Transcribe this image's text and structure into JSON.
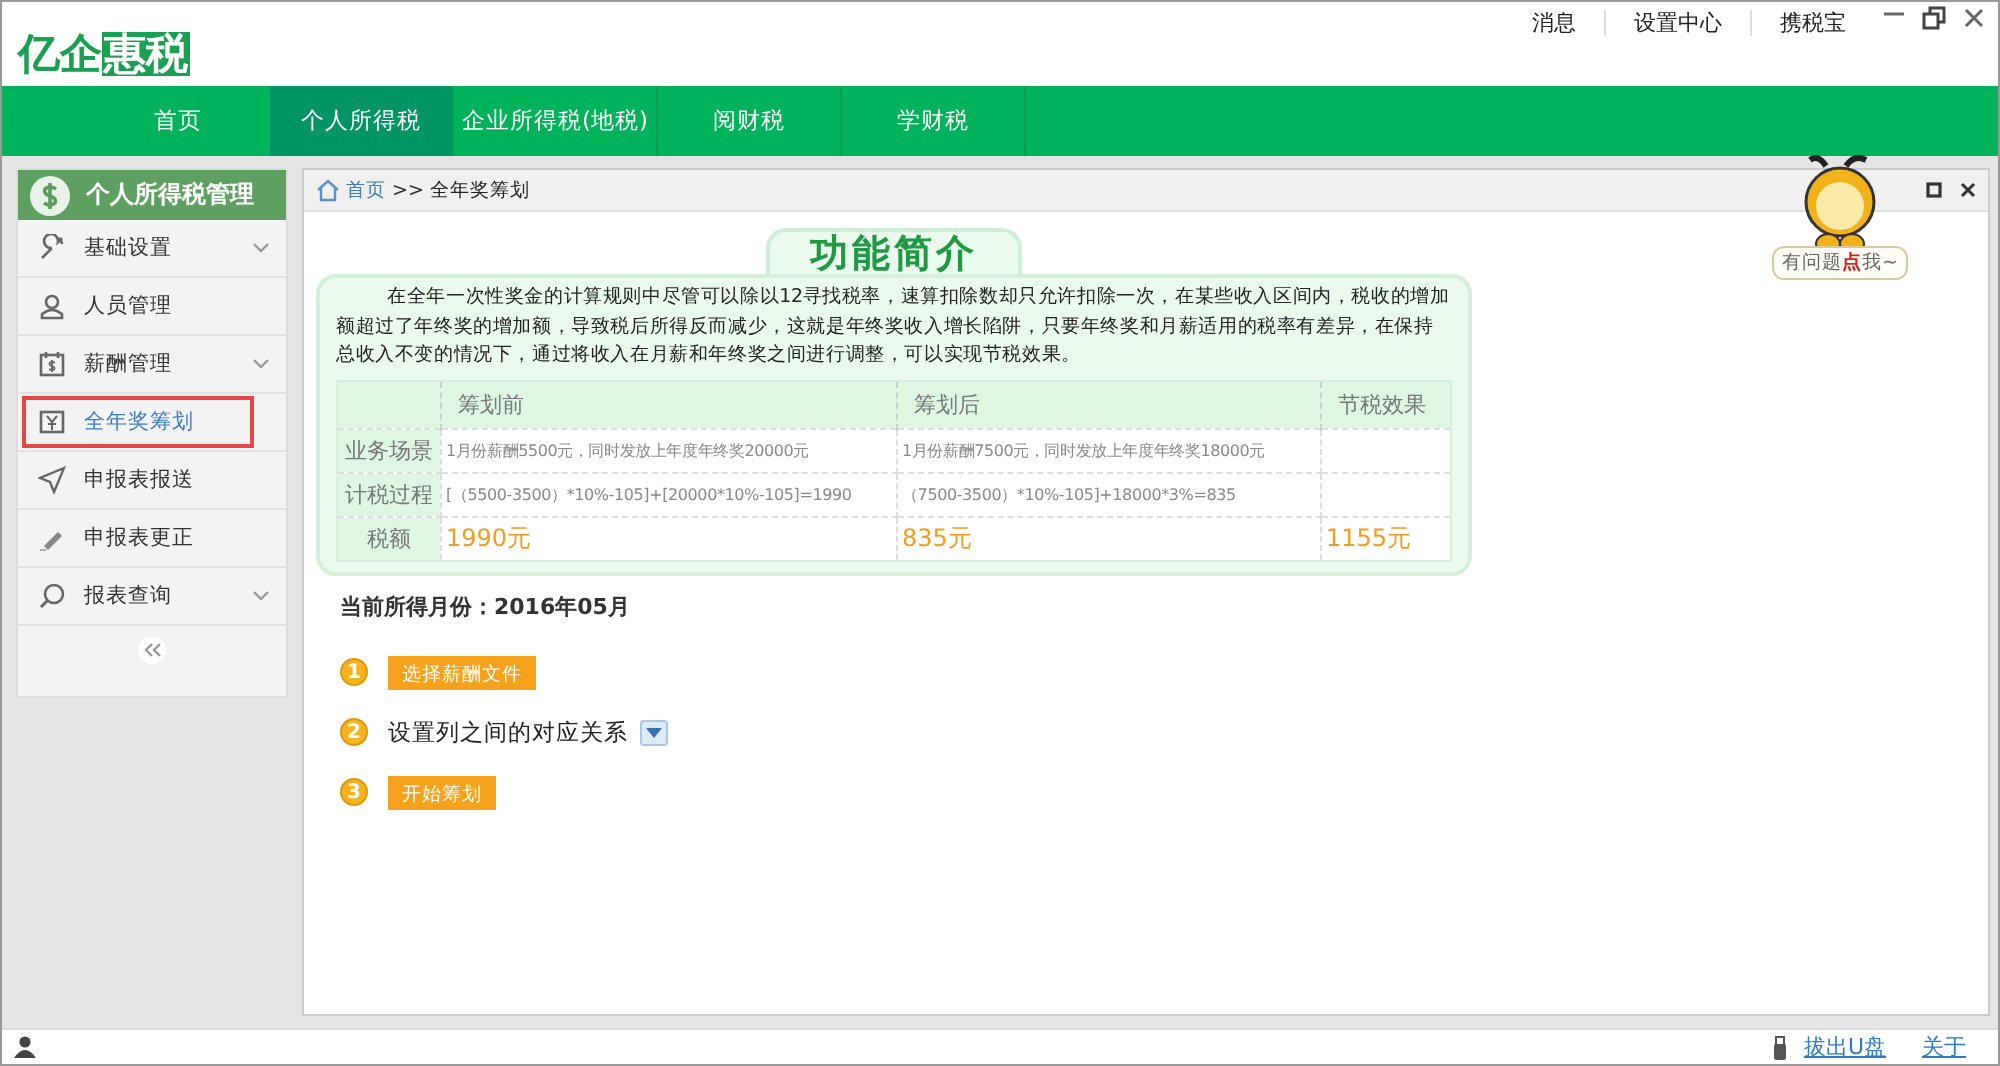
{
  "logo": {
    "plain": "亿企",
    "boxed": "惠税"
  },
  "top_links": [
    "消息",
    "设置中心",
    "携税宝"
  ],
  "nav": [
    {
      "label": "首页",
      "selected": false
    },
    {
      "label": "个人所得税",
      "selected": true
    },
    {
      "label": "企业所得税(地税)",
      "selected": false
    },
    {
      "label": "阅财税",
      "selected": false
    },
    {
      "label": "学财税",
      "selected": false
    }
  ],
  "sidebar": {
    "title": "个人所得税管理",
    "items": [
      {
        "label": "基础设置",
        "expandable": true,
        "selected": false
      },
      {
        "label": "人员管理",
        "expandable": false,
        "selected": false
      },
      {
        "label": "薪酬管理",
        "expandable": true,
        "selected": false
      },
      {
        "label": "全年奖筹划",
        "expandable": false,
        "selected": true
      },
      {
        "label": "申报表报送",
        "expandable": false,
        "selected": false
      },
      {
        "label": "申报表更正",
        "expandable": false,
        "selected": false
      },
      {
        "label": "报表查询",
        "expandable": true,
        "selected": false
      }
    ]
  },
  "breadcrumb": {
    "home": "首页",
    "separator": ">>",
    "current": "全年奖筹划"
  },
  "helper": {
    "bubble": "有问题**点**我~"
  },
  "intro": {
    "title": "功能简介",
    "text": "在全年一次性奖金的计算规则中尽管可以除以12寻找税率，速算扣除数却只允许扣除一次，在某些收入区间内，税收的增加额超过了年终奖的增加额，导致税后所得反而减少，这就是年终奖收入增长陷阱，只要年终奖和月薪适用的税率有差异，在保持总收入不变的情况下，通过将收入在月薪和年终奖之间进行调整，可以实现节税效果。",
    "columns": [
      "筹划前",
      "筹划后",
      "节税效果"
    ],
    "rows": [
      {
        "label": "业务场景",
        "kind": "plain",
        "cells": [
          "1月份薪酬5500元，同时发放上年度年终奖20000元",
          "1月份薪酬7500元，同时发放上年度年终奖18000元"
        ]
      },
      {
        "label": "计税过程",
        "kind": "plain",
        "cells": [
          "[（5500-3500）*10%-105]+[20000*10%-105]=1990",
          "（7500-3500）*10%-105]+18000*3%=835"
        ]
      },
      {
        "label": "税额",
        "kind": "amount",
        "cells": [
          "1990元",
          "835元",
          "1155元"
        ]
      }
    ]
  },
  "month": {
    "label": "当前所得月份：",
    "value": "2016年05月"
  },
  "steps": [
    {
      "number": "1",
      "kind": "button",
      "label": "选择薪酬文件"
    },
    {
      "number": "2",
      "kind": "dropdown",
      "label": "设置列之间的对应关系"
    },
    {
      "number": "3",
      "kind": "button",
      "label": "开始筹划"
    }
  ],
  "status_bar": {
    "links": [
      "拔出U盘",
      "关于"
    ]
  }
}
